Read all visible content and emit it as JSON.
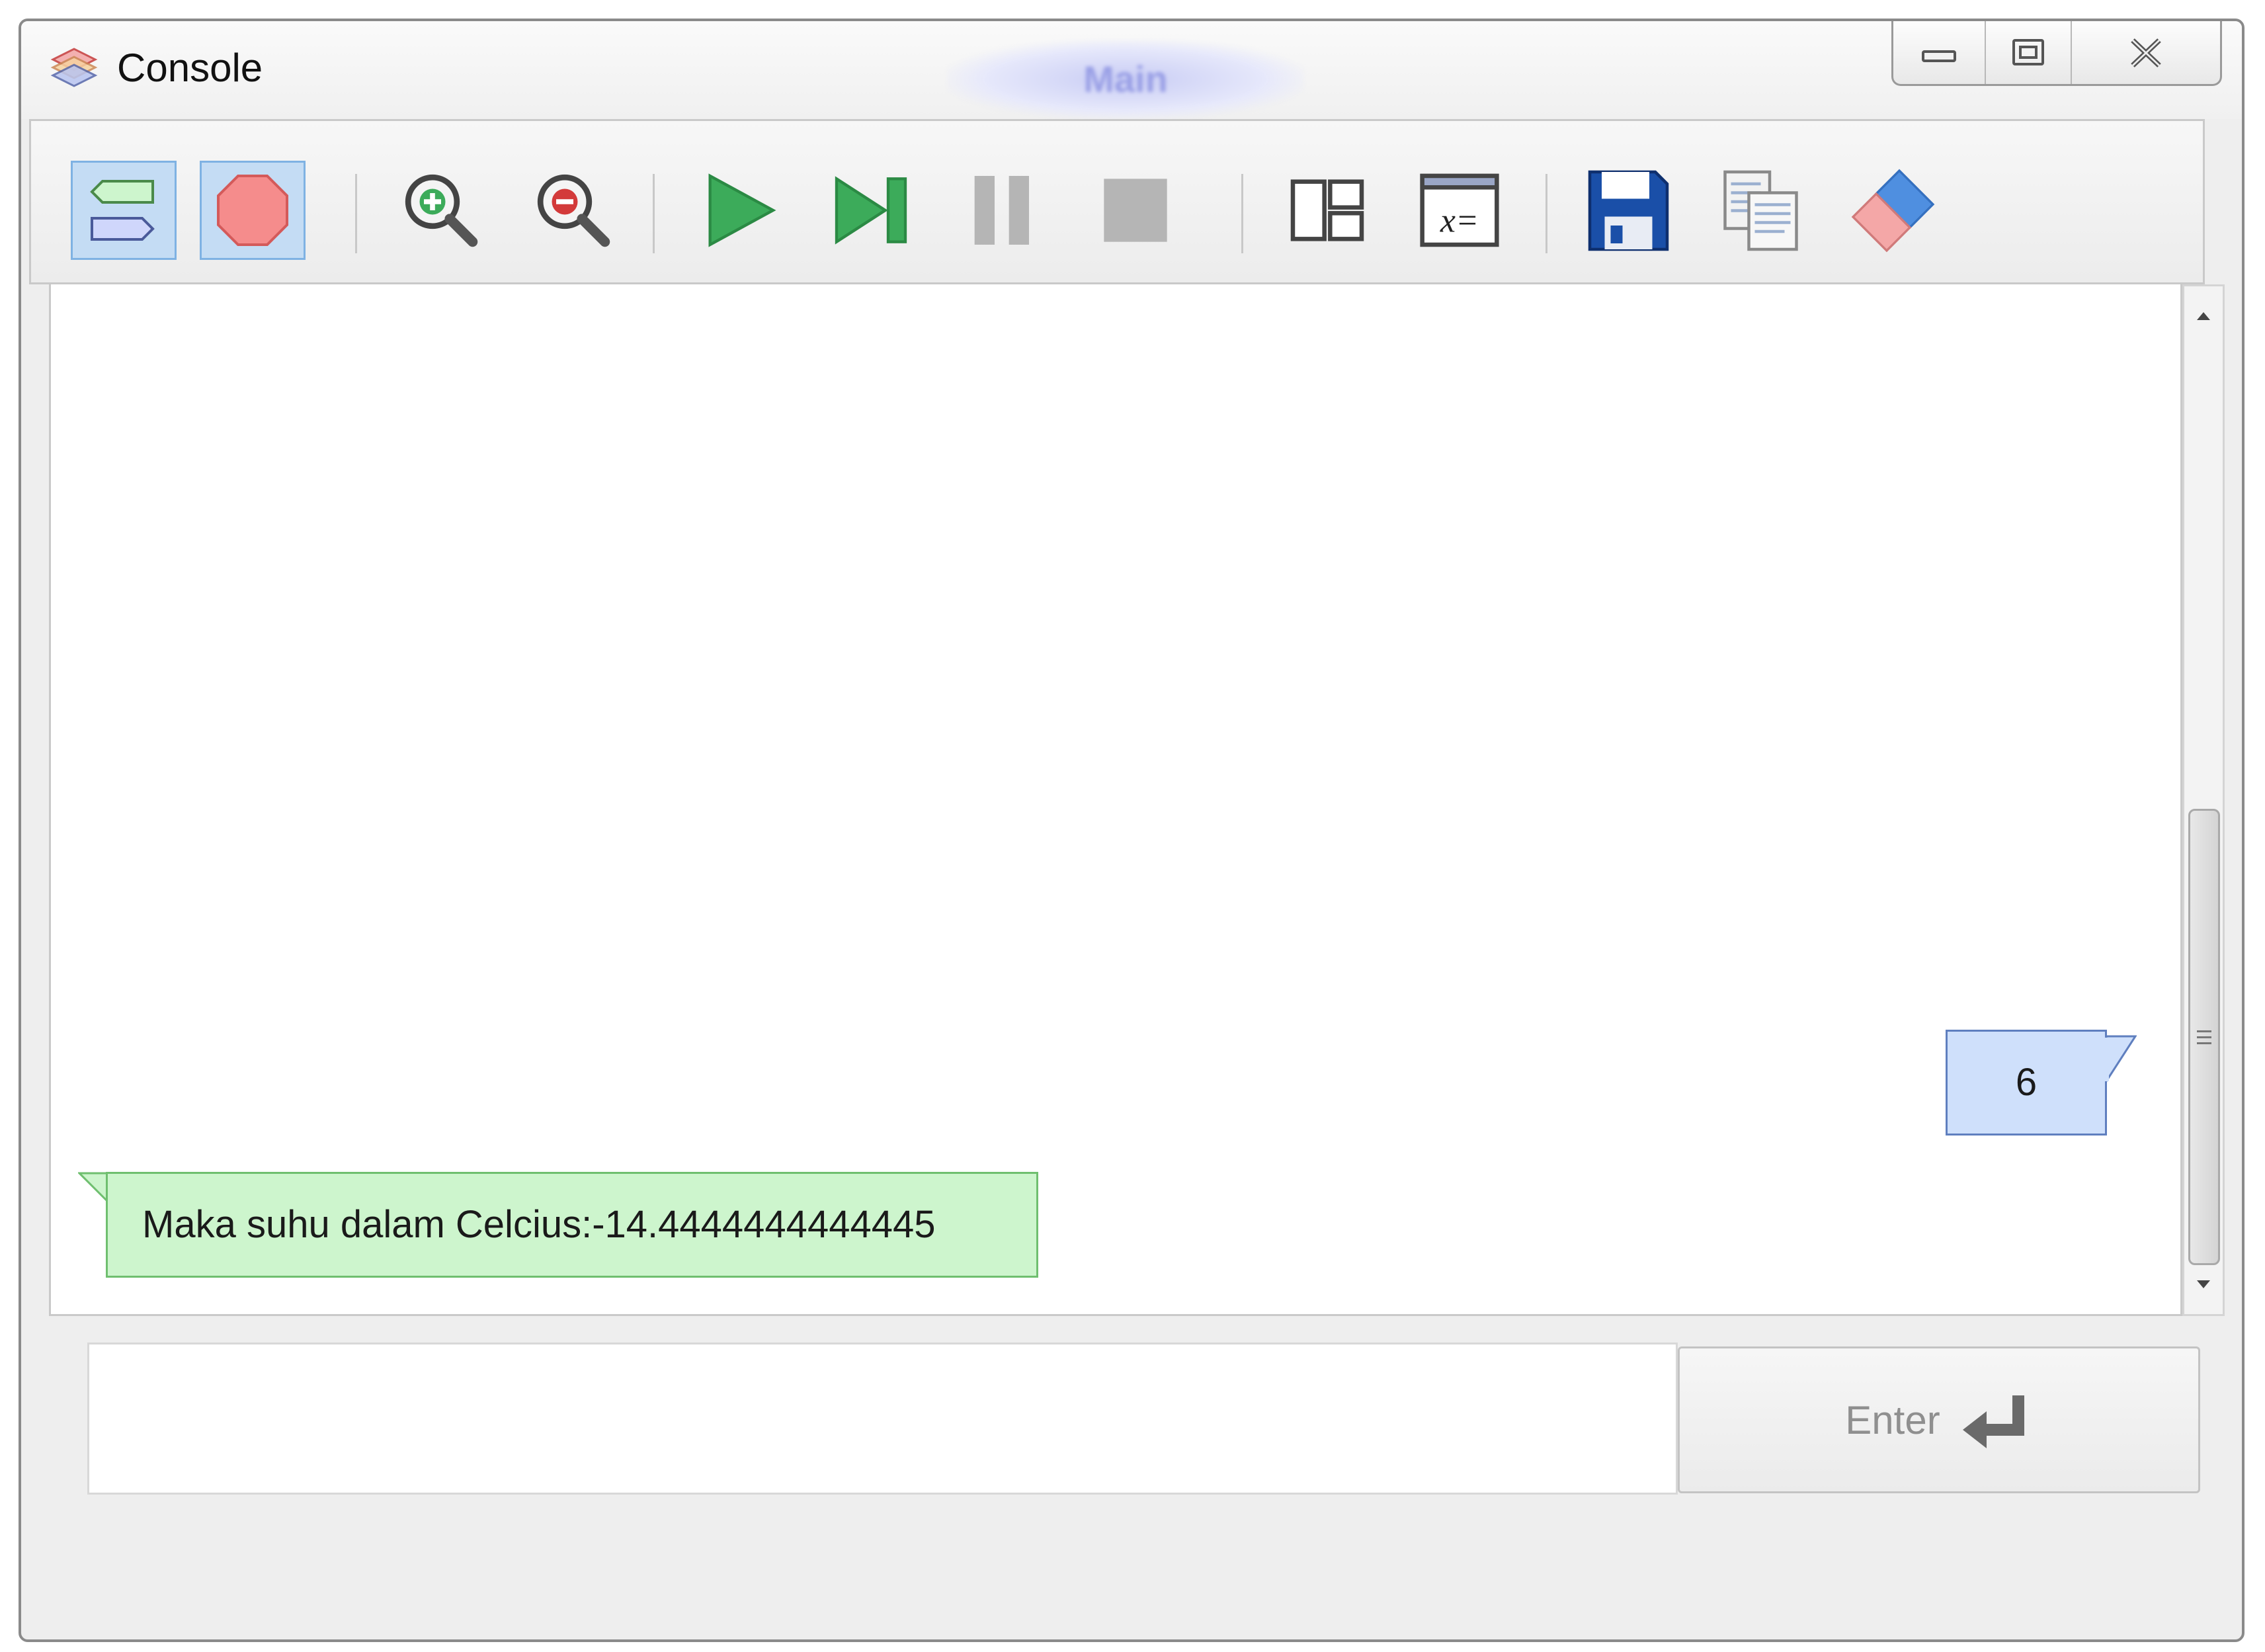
{
  "window": {
    "title": "Console",
    "background_title": "Main",
    "controls": {
      "minimize": "minimize-icon",
      "maximize": "maximize-icon",
      "close": "close-icon"
    }
  },
  "toolbar": {
    "buttons": [
      {
        "name": "io-toggle",
        "icon": "io-icon",
        "active": true
      },
      {
        "name": "stop-breakpoint",
        "icon": "stop-octagon-icon",
        "active": true
      },
      {
        "name": "zoom-in",
        "icon": "zoom-in-icon",
        "active": false
      },
      {
        "name": "zoom-out",
        "icon": "zoom-out-icon",
        "active": false
      },
      {
        "name": "run",
        "icon": "play-icon",
        "active": false
      },
      {
        "name": "step",
        "icon": "step-icon",
        "active": false
      },
      {
        "name": "pause",
        "icon": "pause-icon",
        "active": false
      },
      {
        "name": "stop",
        "icon": "stop-icon",
        "active": false
      },
      {
        "name": "layout",
        "icon": "layout-icon",
        "active": false
      },
      {
        "name": "variables",
        "icon": "variables-icon",
        "active": false
      },
      {
        "name": "save",
        "icon": "save-icon",
        "active": false
      },
      {
        "name": "copy",
        "icon": "copy-icon",
        "active": false
      },
      {
        "name": "clear",
        "icon": "eraser-icon",
        "active": false
      }
    ]
  },
  "console": {
    "output_message": "Maka suhu dalam Celcius:-14.4444444444445",
    "input_echo": "6"
  },
  "input": {
    "value": "",
    "enter_label": "Enter"
  },
  "colors": {
    "output_bubble": "#cdf5cd",
    "input_bubble": "#cfe0fb",
    "active_button": "#c4dcf4",
    "play_green": "#3cab5a",
    "save_blue": "#1a4fa8"
  }
}
